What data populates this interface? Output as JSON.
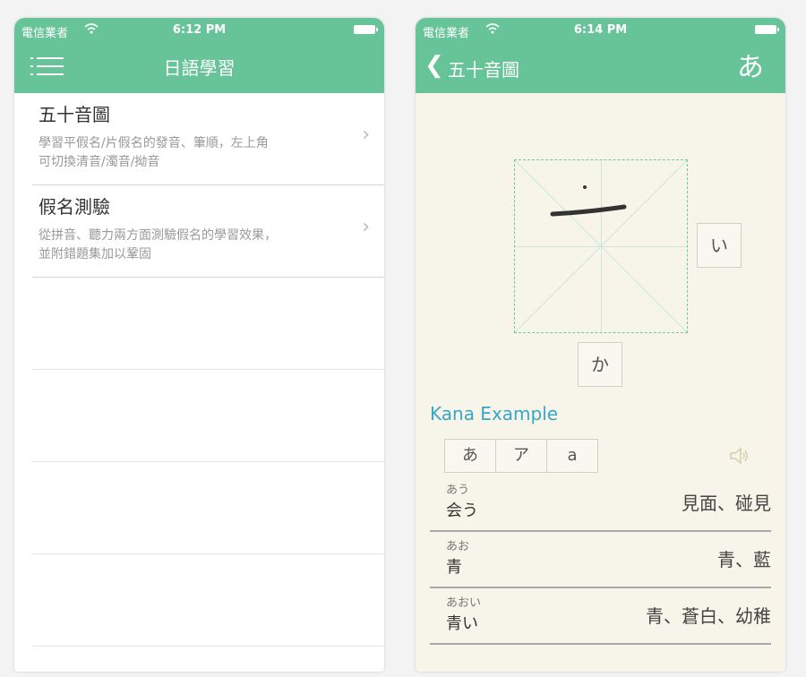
{
  "left": {
    "status": {
      "carrier": "電信業者",
      "time": "6:12 PM"
    },
    "nav": {
      "title": "日語學習"
    },
    "items": [
      {
        "title": "五十音圖",
        "desc_line1": "學習平假名/片假名的發音、筆順，左上角",
        "desc_line2": "可切換清音/濁音/拗音"
      },
      {
        "title": "假名測驗",
        "desc_line1": "從拼音、聽力兩方面測驗假名的學習效果，",
        "desc_line2": "並附錯題集加以鞏固"
      }
    ]
  },
  "right": {
    "status": {
      "carrier": "電信業者",
      "time": "6:14 PM"
    },
    "nav": {
      "back_label": "五十音圖",
      "toggle_label": "あ"
    },
    "next_char": "い",
    "below_char": "か",
    "example_title": "Kana Example",
    "tabs": [
      "あ",
      "ア",
      "a"
    ],
    "words": [
      {
        "reading": "あう",
        "kanji": "会う",
        "meaning": "見面、碰見"
      },
      {
        "reading": "あお",
        "kanji": "青",
        "meaning": "青、藍"
      },
      {
        "reading": "あおい",
        "kanji": "青い",
        "meaning": "青、蒼白、幼稚"
      }
    ]
  },
  "colors": {
    "accent": "#67c398",
    "example_title": "#37a6c8",
    "right_bg": "#f7f5e9"
  },
  "icons": {
    "menu": "hamburger-icon",
    "back": "chevron-left-icon",
    "speaker": "speaker-icon",
    "row": "chevron-right-icon",
    "wifi": "wifi-icon",
    "battery": "battery-icon"
  }
}
